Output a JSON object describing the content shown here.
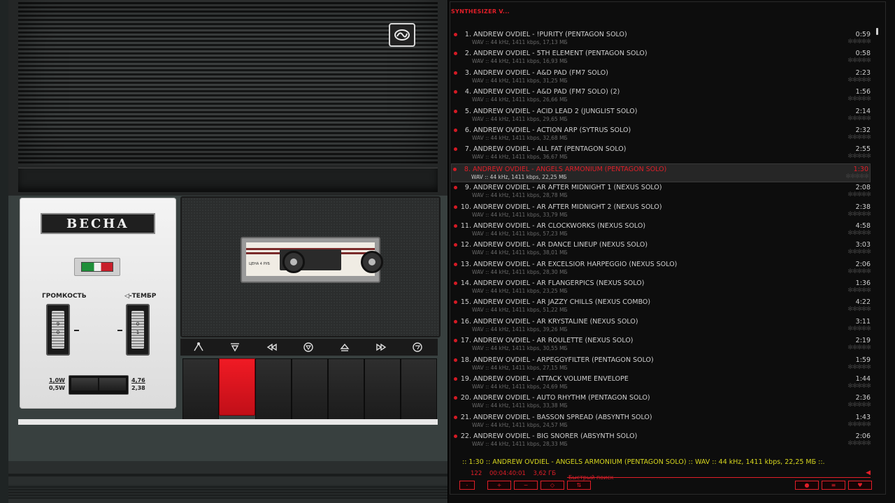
{
  "player": {
    "brand": "ВЕСНА",
    "volume_label": "ГРОМКОСТЬ",
    "tone_label": "◁-ТЕМБР",
    "volume_marks": [
      "0",
      "9"
    ],
    "tone_marks": [
      "0",
      "1"
    ],
    "power_top": "1,0W",
    "power_bottom": "0,5W",
    "speed_top": "4,76",
    "speed_bottom": "2,38",
    "cassette_price": "ЦЕНА 4 РУБ",
    "control_icons": [
      "record-icon",
      "pause-icon",
      "rewind-icon",
      "stop-icon",
      "eject-icon",
      "fast-forward-icon",
      "play-icon"
    ]
  },
  "playlist": {
    "title": "SYNTHESIZER V...",
    "tracks": [
      {
        "num": "1.",
        "title": "ANDREW OVDIEL - !PURITY (PENTAGON SOLO)",
        "info": "WAV :: 44 kHz, 1411 kbps, 17,13 МБ",
        "duration": "0:59"
      },
      {
        "num": "2.",
        "title": "ANDREW OVDIEL - 5TH ELEMENT (PENTAGON SOLO)",
        "info": "WAV :: 44 kHz, 1411 kbps, 16,93 МБ",
        "duration": "0:58"
      },
      {
        "num": "3.",
        "title": "ANDREW OVDIEL - A&D PAD (FM7 SOLO)",
        "info": "WAV :: 44 kHz, 1411 kbps, 31,25 МБ",
        "duration": "2:23"
      },
      {
        "num": "4.",
        "title": "ANDREW OVDIEL - A&D PAD (FM7 SOLO) (2)",
        "info": "WAV :: 44 kHz, 1411 kbps, 26,66 МБ",
        "duration": "1:56"
      },
      {
        "num": "5.",
        "title": "ANDREW OVDIEL - ACID LEAD 2 (JUNGLIST SOLO)",
        "info": "WAV :: 44 kHz, 1411 kbps, 29,65 МБ",
        "duration": "2:14"
      },
      {
        "num": "6.",
        "title": "ANDREW OVDIEL - ACTION ARP (SYTRUS SOLO)",
        "info": "WAV :: 44 kHz, 1411 kbps, 32,68 МБ",
        "duration": "2:32"
      },
      {
        "num": "7.",
        "title": "ANDREW OVDIEL - ALL FAT (PENTAGON SOLO)",
        "info": "WAV :: 44 kHz, 1411 kbps, 36,67 МБ",
        "duration": "2:55"
      },
      {
        "num": "8.",
        "title": "ANDREW OVDIEL - ANGELS ARMONIUM (PENTAGON SOLO)",
        "info": "WAV :: 44 kHz, 1411 kbps, 22,25 МБ",
        "duration": "1:30",
        "active": true
      },
      {
        "num": "9.",
        "title": "ANDREW OVDIEL - AR AFTER MIDNIGHT 1 (NEXUS SOLO)",
        "info": "WAV :: 44 kHz, 1411 kbps, 28,78 МБ",
        "duration": "2:08"
      },
      {
        "num": "10.",
        "title": "ANDREW OVDIEL - AR AFTER MIDNIGHT 2 (NEXUS SOLO)",
        "info": "WAV :: 44 kHz, 1411 kbps, 33,79 МБ",
        "duration": "2:38"
      },
      {
        "num": "11.",
        "title": "ANDREW OVDIEL - AR CLOCKWORKS (NEXUS SOLO)",
        "info": "WAV :: 44 kHz, 1411 kbps, 57,23 МБ",
        "duration": "4:58"
      },
      {
        "num": "12.",
        "title": "ANDREW OVDIEL - AR DANCE LINEUP (NEXUS SOLO)",
        "info": "WAV :: 44 kHz, 1411 kbps, 38,01 МБ",
        "duration": "3:03"
      },
      {
        "num": "13.",
        "title": "ANDREW OVDIEL - AR EXCELSIOR HARPEGGIO (NEXUS SOLO)",
        "info": "WAV :: 44 kHz, 1411 kbps, 28,30 МБ",
        "duration": "2:06"
      },
      {
        "num": "14.",
        "title": "ANDREW OVDIEL - AR FLANGERPICS (NEXUS SOLO)",
        "info": "WAV :: 44 kHz, 1411 kbps, 23,25 МБ",
        "duration": "1:36"
      },
      {
        "num": "15.",
        "title": "ANDREW OVDIEL - AR JAZZY CHILLS (NEXUS COMBO)",
        "info": "WAV :: 44 kHz, 1411 kbps, 51,22 МБ",
        "duration": "4:22"
      },
      {
        "num": "16.",
        "title": "ANDREW OVDIEL - AR KRYSTALINE (NEXUS SOLO)",
        "info": "WAV :: 44 kHz, 1411 kbps, 39,26 МБ",
        "duration": "3:11"
      },
      {
        "num": "17.",
        "title": "ANDREW OVDIEL - AR ROULETTE (NEXUS SOLO)",
        "info": "WAV :: 44 kHz, 1411 kbps, 30,55 МБ",
        "duration": "2:19"
      },
      {
        "num": "18.",
        "title": "ANDREW OVDIEL - ARPEGGYFILTER (PENTAGON SOLO)",
        "info": "WAV :: 44 kHz, 1411 kbps, 27,15 МБ",
        "duration": "1:59"
      },
      {
        "num": "19.",
        "title": "ANDREW OVDIEL - ATTACK VOLUME ENVELOPE",
        "info": "WAV :: 44 kHz, 1411 kbps, 24,69 МБ",
        "duration": "1:44"
      },
      {
        "num": "20.",
        "title": "ANDREW OVDIEL - AUTO RHYTHM (PENTAGON SOLO)",
        "info": "WAV :: 44 kHz, 1411 kbps, 33,38 МБ",
        "duration": "2:36"
      },
      {
        "num": "21.",
        "title": "ANDREW OVDIEL - BASSON SPREAD (ABSYNTH SOLO)",
        "info": "WAV :: 44 kHz, 1411 kbps, 24,57 МБ",
        "duration": "1:43"
      },
      {
        "num": "22.",
        "title": "ANDREW OVDIEL - BIG SNORER (ABSYNTH SOLO)",
        "info": "WAV :: 44 kHz, 1411 kbps, 28,33 МБ",
        "duration": "2:06"
      }
    ],
    "rating_stars": "✻✻✻✻✻",
    "now_playing": ":: 1:30 :: ANDREW OVDIEL - ANGELS ARMONIUM (PENTAGON SOLO) :: WAV :: 44 kHz, 1411 kbps, 22,25 МБ ::.",
    "stats": {
      "count": "122",
      "total_time": "00:04:40:01",
      "total_size": "3,62 ГБ"
    },
    "search_placeholder": "Быстрый поиск",
    "buttons_left": [
      "-",
      "+",
      "−",
      "◇",
      "⇅"
    ],
    "buttons_right": [
      "●",
      "≡",
      "♥"
    ]
  },
  "colors": {
    "accent": "#e01e28",
    "now_playing": "#d6d61e",
    "text": "#cfcfcf",
    "meta": "#6a6a6a"
  }
}
